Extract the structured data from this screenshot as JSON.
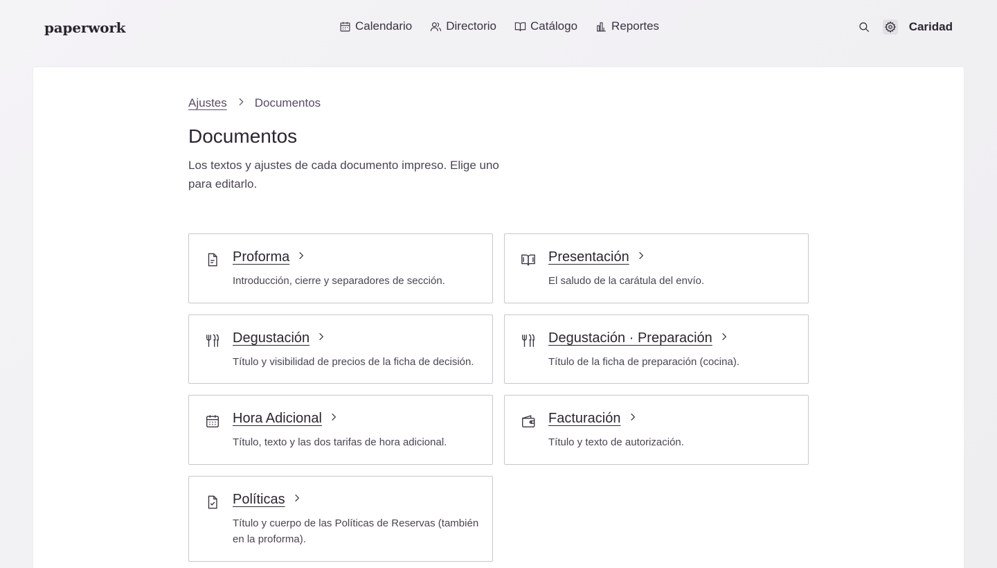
{
  "app": {
    "brand": "paperwork"
  },
  "nav": [
    {
      "label": "Calendario",
      "icon": "calendar-icon"
    },
    {
      "label": "Directorio",
      "icon": "users-icon"
    },
    {
      "label": "Catálogo",
      "icon": "book-icon"
    },
    {
      "label": "Reportes",
      "icon": "bar-chart-icon"
    }
  ],
  "header": {
    "user": "Caridad",
    "search_icon": "search-icon",
    "settings_icon": "gear-icon"
  },
  "breadcrumb": {
    "parent": "Ajustes",
    "current": "Documentos"
  },
  "page": {
    "title": "Documentos",
    "description": "Los textos y ajustes de cada documento impreso. Elige uno para editarlo."
  },
  "cards": [
    {
      "title": "Proforma",
      "desc": "Introducción, cierre y separadores de sección.",
      "icon": "document-icon"
    },
    {
      "title": "Presentación",
      "desc": "El saludo de la carátula del envío.",
      "icon": "open-book-icon"
    },
    {
      "title": "Degustación",
      "desc": "Título y visibilidad de precios de la ficha de decisión.",
      "icon": "utensils-icon"
    },
    {
      "title": "Degustación · Preparación",
      "desc": "Título de la ficha de preparación (cocina).",
      "icon": "utensils-icon"
    },
    {
      "title": "Hora Adicional",
      "desc": "Título, texto y las dos tarifas de hora adicional.",
      "icon": "calendar-icon"
    },
    {
      "title": "Facturación",
      "desc": "Título y texto de autorización.",
      "icon": "wallet-icon"
    },
    {
      "title": "Políticas",
      "desc": "Título y cuerpo de las Políticas de Reservas (también en la proforma).",
      "icon": "document-check-icon"
    }
  ],
  "colors": {
    "accent": "#5a4a66",
    "text": "#2a2530",
    "border": "#c9c6ce",
    "background": "#f2f1f4"
  }
}
